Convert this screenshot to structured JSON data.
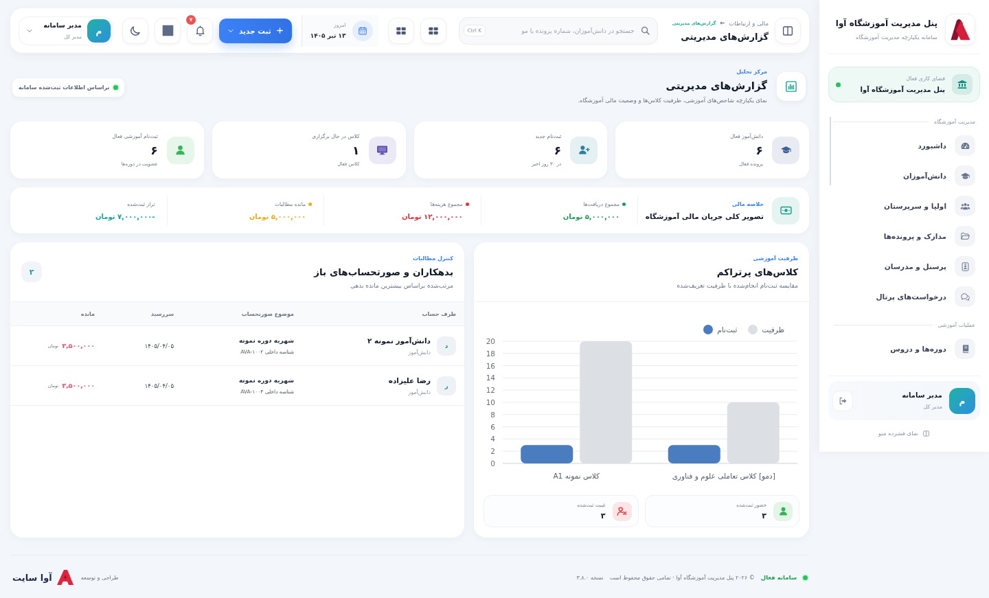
{
  "sidebar": {
    "brand": {
      "title": "پنل مدیریت آموزشگاه آوا",
      "subtitle": "سامانه یکپارچه مدیریت آموزشگاه"
    },
    "workspace": {
      "label": "فضای کاری فعال",
      "name": "پنل مدیریت آموزشگاه آوا",
      "active": true
    },
    "sections": [
      {
        "title": "مدیریت آموزشگاه",
        "items": [
          {
            "label": "داشبورد",
            "selected": false
          },
          {
            "label": "دانش‌آموزان",
            "selected": false
          },
          {
            "label": "اولیا و سرپرستان",
            "selected": false
          },
          {
            "label": "مدارک و پرونده‌ها",
            "selected": false
          },
          {
            "label": "پرسنل و مدرسان",
            "selected": false
          },
          {
            "label": "درخواست‌های پرتال",
            "selected": false
          }
        ]
      },
      {
        "title": "عملیات آموزشی",
        "items": [
          {
            "label": "دوره‌ها و دروس",
            "selected": false
          }
        ]
      }
    ],
    "user": {
      "avatar": "م",
      "name": "مدیر سامانه",
      "role": "مدیر کل"
    },
    "compact_toggle": "نمای فشرده منو"
  },
  "topbar": {
    "breadcrumb": [
      "مالی و ارتباطات",
      "گزارش‌های مدیریتی"
    ],
    "title": "گزارش‌های مدیریتی",
    "search": {
      "placeholder": "جستجو در دانش‌آموزان، شماره پرونده یا مو",
      "shortcut": "Ctrl K"
    },
    "date": {
      "label": "امروز",
      "value": "۱۳ تیر ۱۴۰۵"
    },
    "new_button": "ثبت جدید",
    "notification_count": "۷",
    "user": {
      "avatar": "م",
      "name": "مدیر سامانه",
      "role": "مدیر کل"
    }
  },
  "page_header": {
    "eyebrow": "مرکز تحلیل",
    "title": "گزارش‌های مدیریتی",
    "description": "نمای یکپارچه شاخص‌های آموزشی، ظرفیت کلاس‌ها و وضعیت مالی آموزشگاه.",
    "source_badge": {
      "label": "براساس اطلاعات ثبت‌شده سامانه",
      "live": true
    }
  },
  "stats": [
    {
      "label": "دانش‌آموز فعال",
      "value": "۶",
      "note": "پرونده فعال",
      "color": "#3f5f95"
    },
    {
      "label": "ثبت‌نام جدید",
      "value": "۶",
      "note": "در ۳۰ روز اخیر",
      "color": "#2a7f9c"
    },
    {
      "label": "کلاس در حال برگزاری",
      "value": "۱",
      "note": "کلاس فعال",
      "color": "#5b49b0"
    },
    {
      "label": "ثبت‌نام آموزشی فعال",
      "value": "۶",
      "note": "عضویت در دوره‌ها",
      "color": "#37b45a"
    }
  ],
  "finance": {
    "eyebrow": "خلاصه مالی",
    "title": "تصویر کلی جریان مالی آموزشگاه",
    "metrics": [
      {
        "label": "مجموع دریافت‌ها",
        "value": "۵,۰۰۰,۰۰۰ تومان",
        "color": "#1f9a55",
        "dot": true
      },
      {
        "label": "مجموع هزینه‌ها",
        "value": "۱۲,۰۰۰,۰۰۰ تومان",
        "color": "#e0323f",
        "dot": true
      },
      {
        "label": "مانده مطالبات",
        "value": "۵,۰۰۰,۰۰۰ تومان",
        "color": "#f0ad0e",
        "dot": true
      },
      {
        "label": "تراز ثبت‌شده",
        "value": "-۷,۰۰۰,۰۰۰ تومان",
        "color": "#12a79a",
        "dot": false
      }
    ]
  },
  "capacity_panel": {
    "eyebrow": "ظرفیت آموزشی",
    "title": "کلاس‌های پرتراکم",
    "subtitle": "مقایسه ثبت‌نام انجام‌شده با ظرفیت تعریف‌شده",
    "chart_data": {
      "type": "bar",
      "categories": [
        "کلاس نمونه A1",
        "[دمو] کلاس تعاملی علوم و فناوری"
      ],
      "series": [
        {
          "name": "ظرفیت",
          "color": "#dcdfe4",
          "values": [
            20,
            10
          ]
        },
        {
          "name": "ثبت‌نام",
          "color": "#4a7cc0",
          "values": [
            3,
            3
          ]
        }
      ],
      "ylim": [
        0,
        20
      ],
      "yticks": [
        0,
        2,
        4,
        6,
        8,
        10,
        12,
        14,
        16,
        18,
        20
      ],
      "grid": true,
      "legend": "top"
    },
    "summary": [
      {
        "label": "حضور ثبت‌شده",
        "value": "۳",
        "color": "#2fb457"
      },
      {
        "label": "غیبت ثبت‌شده",
        "value": "۳",
        "color": "#e5484d"
      }
    ]
  },
  "debtors_panel": {
    "eyebrow": "کنترل مطالبات",
    "title": "بدهکاران و صورتحساب‌های باز",
    "subtitle": "مرتب‌شده براساس بیشترین مانده بدهی",
    "count": "۲",
    "columns": [
      "طرف حساب",
      "موضوع صورتحساب",
      "سررسید",
      "مانده"
    ],
    "rows": [
      {
        "avatar": "د",
        "name": "دانش‌آموز نمونه ۲",
        "type": "دانش‌آموز",
        "subject": "شهریه دوره نمونه",
        "reference": "شناسه داخلی AVA-۱۰۰۲",
        "due": "۱۴۰۵/۰۴/۰۵",
        "amount": "۲,۵۰۰,۰۰۰",
        "currency": "تومان"
      },
      {
        "avatar": "ر",
        "name": "رضا علیزاده",
        "type": "دانش‌آموز",
        "subject": "شهریه دوره نمونه",
        "reference": "شناسه داخلی AVA-۱۰۰۳",
        "due": "۱۴۰۵/۰۴/۰۵",
        "amount": "۲,۵۰۰,۰۰۰",
        "currency": "تومان"
      }
    ]
  },
  "footer": {
    "status": "سامانه فعال",
    "online": true,
    "copyright": "© ۲۰۲۶ پنل مدیریت آموزشگاه آوا · تمامی حقوق محفوظ است",
    "version": "نسخه ۳.۸.۰",
    "credit": "طراحی و توسعه",
    "brand": "آوا سایت"
  }
}
